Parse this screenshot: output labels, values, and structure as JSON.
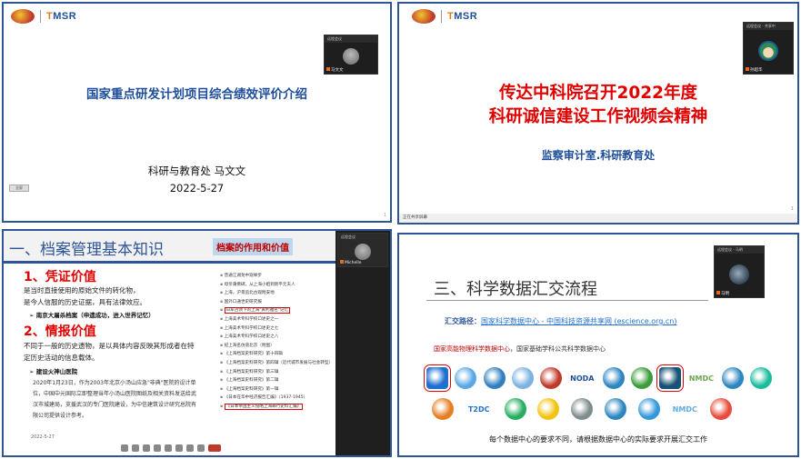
{
  "layout": "2x2 video-conference grid",
  "panel1": {
    "title": "国家重点研发计划项目综合绩效评价介绍",
    "presenter": "科研与教育处 马文文",
    "date": "2022-5-27",
    "video_tile": {
      "header": "远程会议",
      "name": "马文文"
    },
    "corner_button": "全屏",
    "page": "1"
  },
  "panel2": {
    "title_line1": "传达中科院召开2022年度",
    "title_line2": "科研诚信建设工作视频会精神",
    "subtitle": "监察审计室.科研教育处",
    "video_tile": {
      "header": "远程会议 · 共享中",
      "name": "孙超华"
    },
    "status": "正在共享屏幕",
    "page": "1"
  },
  "panel3": {
    "title": "一、档案管理基本知识",
    "tag": "档案的作用和价值",
    "video_tile": {
      "header": "远程会议",
      "name": "Michelle"
    },
    "section1_title": "1、凭证价值",
    "section1_lines": [
      "是当时直接使用的原始文件的转化物，",
      "是今人信服的历史证据，具有法律效应。"
    ],
    "section1_bullet": "南京大屠杀档案（申遗成功，进入世界记忆）",
    "section2_title": "2、情报价值",
    "section2_lines": [
      "不同于一般的历史遗物，是以具体内容反映其形成者在特",
      "定历史活动的信息载体。"
    ],
    "section2_bullet": "建设火神山医院",
    "section2_detail": [
      "2020年1月23日，作为2003年北京小汤山应急\"非典\"医院的设计单",
      "位，中国中元国际立即整理当年小汤山医院图纸及相关资料发送给武",
      "汉市城建局，支援武汉的专门医院建设，为中信建筑设计研究总院有",
      "限公司提供设计参考。"
    ],
    "right_list": [
      "普通江湖龙中观举步",
      "母亲蒲佛碑，从上海小姐到新平元夫人",
      "上海，沪景追北古观附安地",
      "国外口通世史研究报",
      "日军占领下的上海\"黄利雅名\"记忆",
      "上海美术专科学校口述史之一",
      "上海美术专科学校口述史之七",
      "上海美术专科学校口述史之八",
      "纪上海名仿道北京（附图）",
      "《上海档案史料研究》第十四辑",
      "《上海档案史料研究》第四辑（近代城市发展与社会转型）",
      "《上海档案史料研究》第三辑",
      "《上海档案史料研究》第二辑",
      "《上海档案史料研究》第一辑",
      "《日本在华中经济报告汇编》（1937-1945）",
      "《日本帝国主义侵略上海罪行史料汇编》"
    ],
    "date": "2022-5-27",
    "toolbar": [
      "mute",
      "video",
      "share",
      "participants",
      "chat",
      "record",
      "reactions",
      "apps",
      "end"
    ]
  },
  "panel4": {
    "title": "三、科学数据汇交流程",
    "route_label": "汇交路径：",
    "route_link": "国家科学数据中心 - 中国科技资源共享网 (escience.org.cn)",
    "centers_red": "国家高能物理科学数据中心",
    "centers_black": "，国家基础学科公共科学数据中心",
    "video_tile": {
      "header": "远程会议 · 马明",
      "name": "马明"
    },
    "note": "每个数据中心的要求不同，请根据数据中心的实际要求开展汇交工作",
    "row1": [
      {
        "color": "#1f6fd1",
        "sel": true
      },
      {
        "color": "#5aa9e6"
      },
      {
        "color": "#2f7fc1"
      },
      {
        "color": "#7db3e0"
      },
      {
        "color": "#c0392b"
      },
      {
        "text": "NODA",
        "color": "#1f4e9b"
      },
      {
        "color": "#2e86c1"
      },
      {
        "color": "#3a9d3a"
      },
      {
        "color": "#1a5276",
        "sel": true
      },
      {
        "text": "NMDC",
        "color": "#6aa84f"
      },
      {
        "color": "#2e86c1"
      },
      {
        "color": "#1abc9c"
      }
    ],
    "row2": [
      {
        "color": "#e67e22"
      },
      {
        "text": "T2DC",
        "color": "#1f6fd1"
      },
      {
        "color": "#27ae60"
      },
      {
        "color": "#f1c40f"
      },
      {
        "color": "#7f8c8d"
      },
      {
        "color": "#2e86c1"
      },
      {
        "color": "#3498db"
      },
      {
        "text": "NMDC",
        "color": "#5dade2"
      },
      {
        "color": "#e74c3c"
      }
    ]
  }
}
